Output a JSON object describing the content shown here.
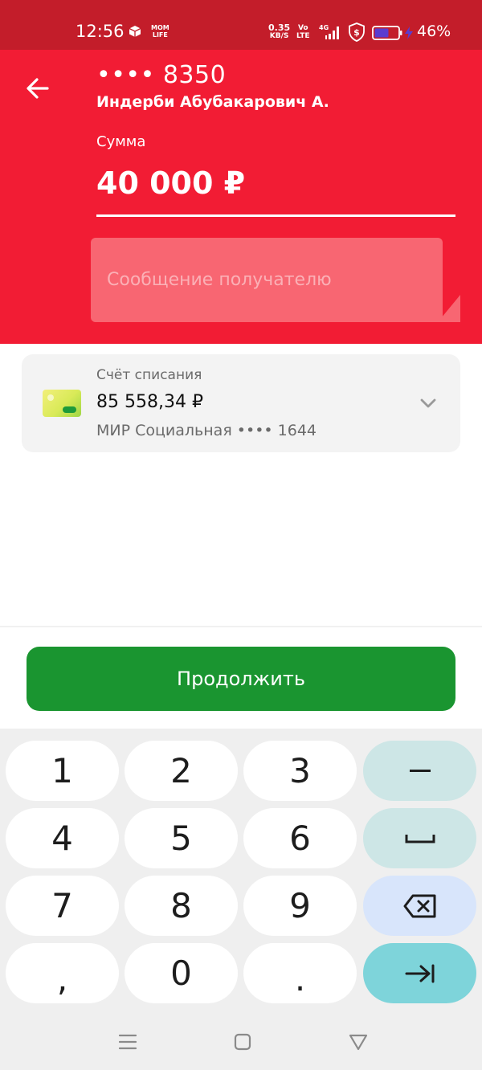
{
  "status_bar": {
    "time": "12:56",
    "momlife_line1": "MOM",
    "momlife_line2": "LIFE",
    "speed_value": "0.35",
    "speed_unit": "KB/S",
    "volte_line1": "Vo",
    "volte_line2": "LTE",
    "network": "4G",
    "battery_percent": "46%"
  },
  "header": {
    "background_color": "#f21c34",
    "card_mask": "•••• 8350",
    "recipient_name": "Индерби Абубакарович А.",
    "amount_label": "Сумма",
    "amount_value": "40 000 ₽",
    "message_placeholder": "Сообщение получателю"
  },
  "account": {
    "label": "Счёт списания",
    "balance": "85 558,34 ₽",
    "card_name": "МИР Социальная •••• 1644"
  },
  "continue_button": {
    "label": "Продолжить",
    "color": "#1a9530"
  },
  "keypad": {
    "keys": [
      "1",
      "2",
      "3",
      "–",
      "4",
      "5",
      "6",
      "␣",
      "7",
      "8",
      "9",
      "⌫",
      ",",
      "0",
      ".",
      "⇥"
    ]
  },
  "nav": {
    "menu": "menu-icon",
    "home": "square-icon",
    "back": "triangle-back-icon"
  }
}
